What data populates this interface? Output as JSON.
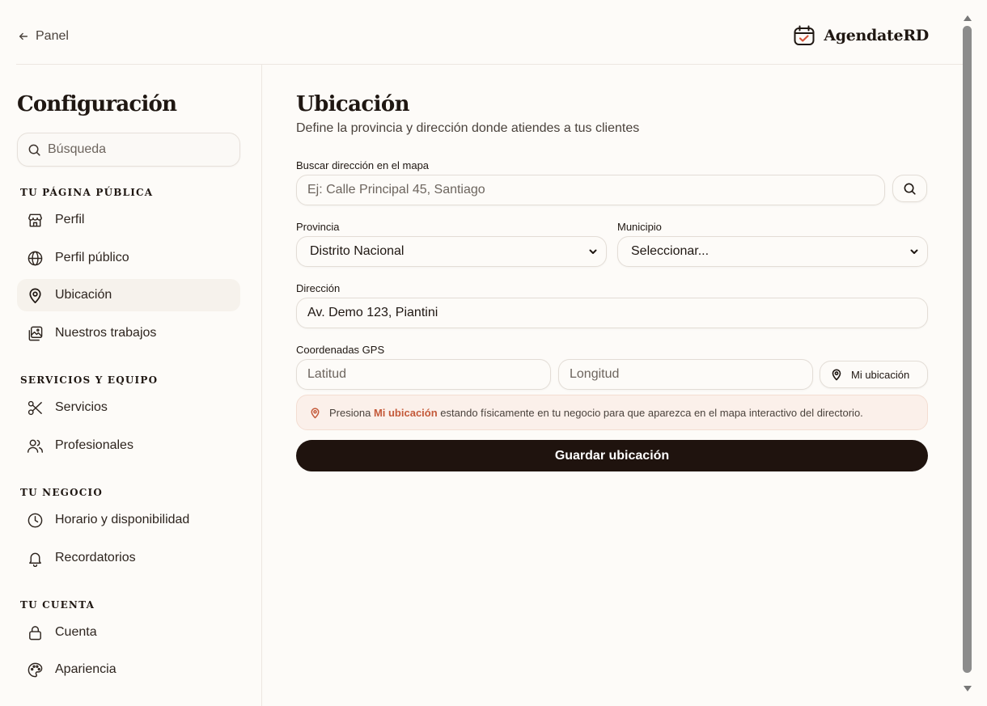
{
  "topbar": {
    "back_label": "Panel",
    "brand_name": "AgendateRD"
  },
  "sidebar": {
    "title": "Configuración",
    "search_placeholder": "Búsqueda",
    "sections": [
      {
        "label": "Tu página pública",
        "items": [
          {
            "label": "Perfil",
            "icon": "store-icon"
          },
          {
            "label": "Perfil público",
            "icon": "globe-icon"
          },
          {
            "label": "Ubicación",
            "icon": "map-pin-icon",
            "active": true
          },
          {
            "label": "Nuestros trabajos",
            "icon": "gallery-icon"
          }
        ]
      },
      {
        "label": "Servicios y equipo",
        "items": [
          {
            "label": "Servicios",
            "icon": "scissors-icon"
          },
          {
            "label": "Profesionales",
            "icon": "users-icon"
          }
        ]
      },
      {
        "label": "Tu negocio",
        "items": [
          {
            "label": "Horario y disponibilidad",
            "icon": "clock-icon"
          },
          {
            "label": "Recordatorios",
            "icon": "bell-icon"
          }
        ]
      },
      {
        "label": "Tu cuenta",
        "items": [
          {
            "label": "Cuenta",
            "icon": "lock-icon"
          },
          {
            "label": "Apariencia",
            "icon": "palette-icon"
          }
        ]
      }
    ]
  },
  "main": {
    "title": "Ubicación",
    "subtitle": "Define la provincia y dirección donde atiendes a tus clientes",
    "map_search": {
      "label": "Buscar dirección en el mapa",
      "placeholder": "Ej: Calle Principal 45, Santiago"
    },
    "province": {
      "label": "Provincia",
      "value": "Distrito Nacional"
    },
    "municipality": {
      "label": "Municipio",
      "value": "Seleccionar..."
    },
    "address": {
      "label": "Dirección",
      "value": "Av. Demo 123, Piantini"
    },
    "gps": {
      "label": "Coordenadas GPS",
      "lat_placeholder": "Latitud",
      "lng_placeholder": "Longitud",
      "my_location_label": "Mi ubicación"
    },
    "notice": {
      "prefix": "Presiona",
      "highlight": "Mi ubicación",
      "suffix": "estando físicamente en tu negocio para que aparezca en el mapa interactivo del directorio."
    },
    "save_label": "Guardar ubicación"
  },
  "colors": {
    "background": "#fdfbf8",
    "primary_button": "#1f130e",
    "accent": "#c45a3a",
    "notice_bg": "#fbf0ea"
  }
}
